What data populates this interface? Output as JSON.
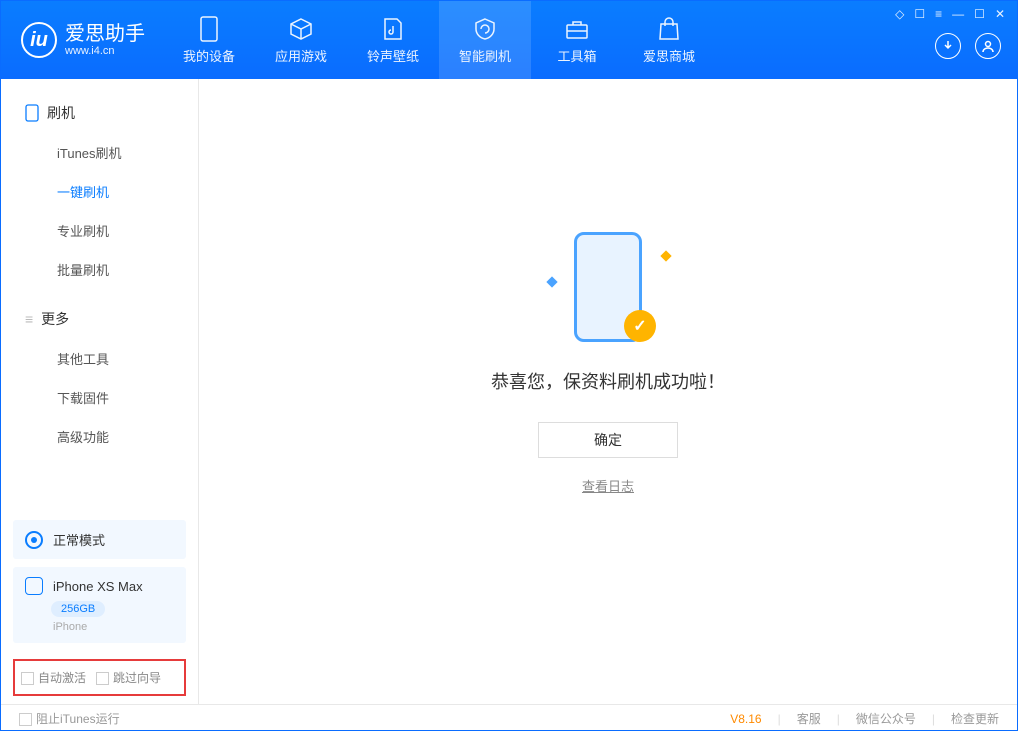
{
  "app": {
    "name": "爱思助手",
    "url": "www.i4.cn"
  },
  "tabs": {
    "device": "我的设备",
    "apps": "应用游戏",
    "wallpaper": "铃声壁纸",
    "flash": "智能刷机",
    "tools": "工具箱",
    "store": "爱思商城"
  },
  "sidebar": {
    "group_flash": "刷机",
    "items_flash": {
      "itunes": "iTunes刷机",
      "oneclick": "一键刷机",
      "pro": "专业刷机",
      "batch": "批量刷机"
    },
    "group_more": "更多",
    "items_more": {
      "other": "其他工具",
      "firmware": "下载固件",
      "advanced": "高级功能"
    }
  },
  "status": {
    "mode": "正常模式"
  },
  "device": {
    "name": "iPhone XS Max",
    "storage": "256GB",
    "type": "iPhone"
  },
  "options": {
    "auto_activate": "自动激活",
    "skip_guide": "跳过向导"
  },
  "main": {
    "success_message": "恭喜您，保资料刷机成功啦！",
    "ok_button": "确定",
    "log_link": "查看日志"
  },
  "footer": {
    "block_itunes": "阻止iTunes运行",
    "version": "V8.16",
    "support": "客服",
    "wechat": "微信公众号",
    "update": "检查更新"
  }
}
